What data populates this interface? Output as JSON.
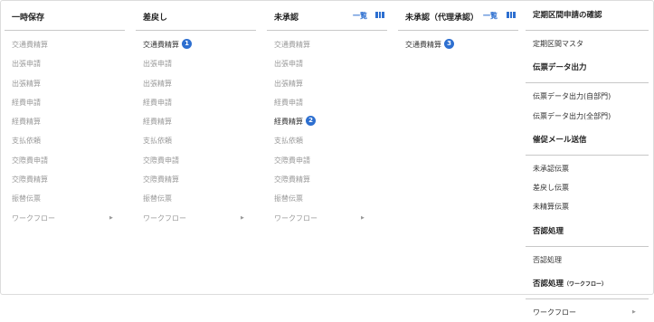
{
  "columns": [
    {
      "title": "一時保存",
      "items": [
        {
          "label": "交通費精算"
        },
        {
          "label": "出張申請"
        },
        {
          "label": "出張精算"
        },
        {
          "label": "経費申請"
        },
        {
          "label": "経費精算"
        },
        {
          "label": "支払依頼"
        },
        {
          "label": "交際費申請"
        },
        {
          "label": "交際費精算"
        },
        {
          "label": "振替伝票"
        },
        {
          "label": "ワークフロー"
        }
      ]
    },
    {
      "title": "差戻し",
      "items": [
        {
          "label": "交通費精算",
          "badge": "1"
        },
        {
          "label": "出張申請"
        },
        {
          "label": "出張精算"
        },
        {
          "label": "経費申請"
        },
        {
          "label": "経費精算"
        },
        {
          "label": "支払依頼"
        },
        {
          "label": "交際費申請"
        },
        {
          "label": "交際費精算"
        },
        {
          "label": "振替伝票"
        },
        {
          "label": "ワークフロー"
        }
      ]
    },
    {
      "title": "未承認",
      "link": "一覧",
      "items": [
        {
          "label": "交通費精算"
        },
        {
          "label": "出張申請"
        },
        {
          "label": "出張精算"
        },
        {
          "label": "経費申請"
        },
        {
          "label": "経費精算",
          "badge": "2"
        },
        {
          "label": "支払依頼"
        },
        {
          "label": "交際費申請"
        },
        {
          "label": "交際費精算"
        },
        {
          "label": "振替伝票"
        },
        {
          "label": "ワークフロー"
        }
      ]
    },
    {
      "title": "未承認（代理承認）",
      "link": "一覧",
      "items": [
        {
          "label": "交通費精算",
          "badge": "3"
        }
      ]
    }
  ],
  "right": {
    "commuter_title": "定期区間申請の確認",
    "commuter_master": "定期区間マスタ",
    "slip_title": "伝票データ出力",
    "slip_own": "伝票データ出力(自部門)",
    "slip_all": "伝票データ出力(全部門)",
    "mail_title": "催促メール送信",
    "mail_unapproved": "未承認伝票",
    "mail_returned": "差戻し伝票",
    "mail_unsettled": "未精算伝票",
    "reject_title": "否認処理",
    "reject_item": "否認処理",
    "reject_wf_title": "否認処理",
    "reject_wf_suffix": "（ワークフロー）",
    "workflow": "ワークフロー"
  },
  "icons": {
    "arrow": "right-triangle",
    "list_view": "column-bars"
  },
  "colors": {
    "accent": "#2d6fd0",
    "disabled_text": "#9a9a9a"
  }
}
